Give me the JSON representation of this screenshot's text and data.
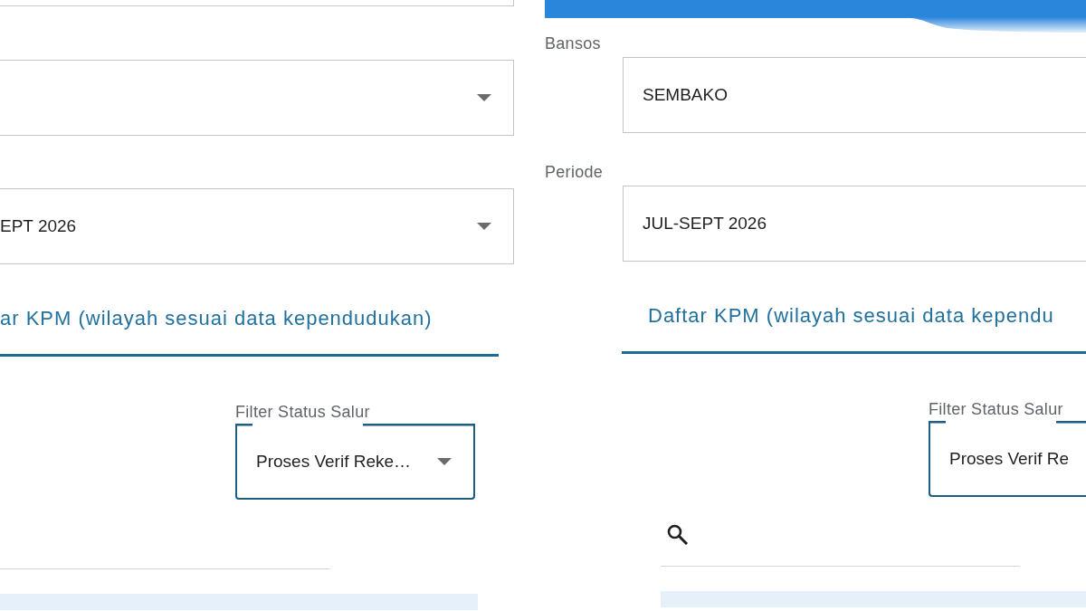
{
  "screens": [
    {
      "fields": [
        {
          "kind": "stub"
        },
        {
          "kind": "dropdown"
        },
        {
          "kind": "dropdown",
          "value": "EPT 2026"
        }
      ],
      "tab": {
        "label": "ar KPM (wilayah sesuai data kependudukan)",
        "selected": true
      },
      "filter": {
        "kind": "dropdown",
        "label": "Filter Status Salur",
        "value": "Proses Verif Reke…"
      },
      "search": {
        "kind": "plain"
      }
    },
    {
      "header_bar": true,
      "fields": [
        {
          "kind": "text",
          "label": "Bansos",
          "value": "SEMBAKO"
        },
        {
          "kind": "text",
          "label": "Periode",
          "value": "JUL-SEPT 2026"
        }
      ],
      "tab": {
        "label": "Daftar KPM (wilayah sesuai data kependu",
        "selected": true
      },
      "filter": {
        "kind": "text",
        "label": "Filter Status Salur",
        "value": "Proses Verif Re"
      },
      "search": {
        "kind": "icon"
      }
    }
  ]
}
